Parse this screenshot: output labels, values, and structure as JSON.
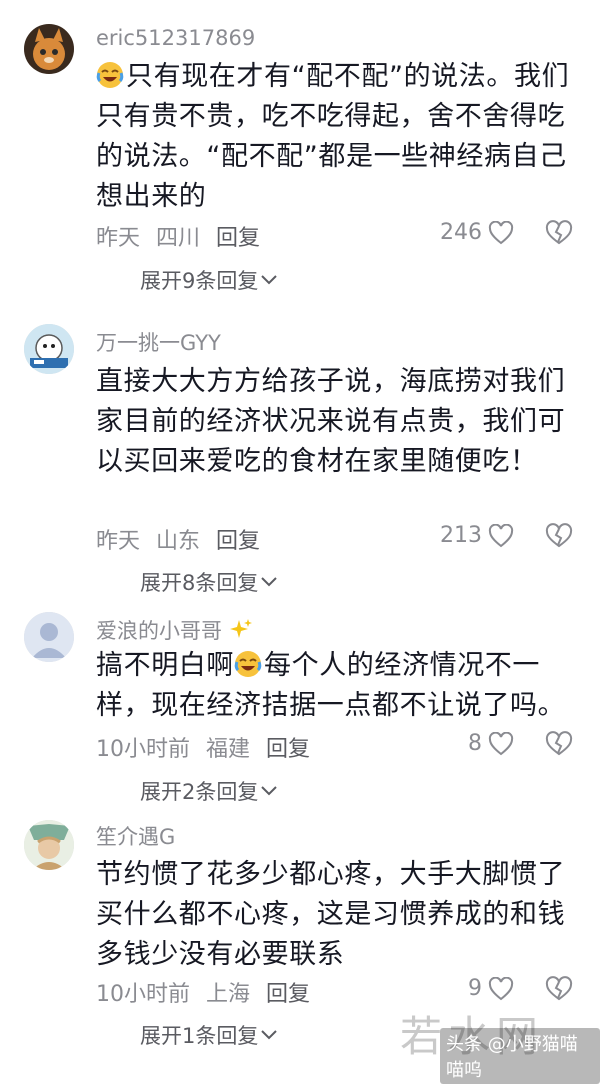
{
  "comments": [
    {
      "username": "eric512317869",
      "text": "只有现在才有“配不配”的说法。我们只有贵不贵，吃不吃得起，舍不舍得吃的说法。“配不配”都是一些神经病自己想出来的",
      "time": "昨天",
      "location": "四川",
      "reply_label": "回复",
      "likes": "246",
      "expand_label": "展开9条回复"
    },
    {
      "username": "万一挑一GYY",
      "text": "直接大大方方给孩子说，海底捞对我们家目前的经济状况来说有点贵，我们可以买回来爱吃的食材在家里随便吃！",
      "time": "昨天",
      "location": "山东",
      "reply_label": "回复",
      "likes": "213",
      "expand_label": "展开8条回复"
    },
    {
      "username": "爱浪的小哥哥",
      "text_before": "搞不明白啊",
      "text_after": "每个人的经济情况不一样，现在经济拮据一点都不让说了吗。",
      "time": "10小时前",
      "location": "福建",
      "reply_label": "回复",
      "likes": "8",
      "expand_label": "展开2条回复"
    },
    {
      "username": "笙介遇G",
      "text": "节约惯了花多少都心疼，大手大脚惯了买什么都不心疼，这是习惯养成的和钱多钱少没有必要联系",
      "time": "10小时前",
      "location": "上海",
      "reply_label": "回复",
      "likes": "9",
      "expand_label": "展开1条回复"
    }
  ],
  "watermark": {
    "brand": "若水网",
    "credit": "头条 @小野猫喵喵呜"
  },
  "icons": [
    "heart-outline-icon",
    "broken-heart-icon",
    "chevron-down-icon",
    "crying-laughing-emoji",
    "sparkles-emoji"
  ]
}
